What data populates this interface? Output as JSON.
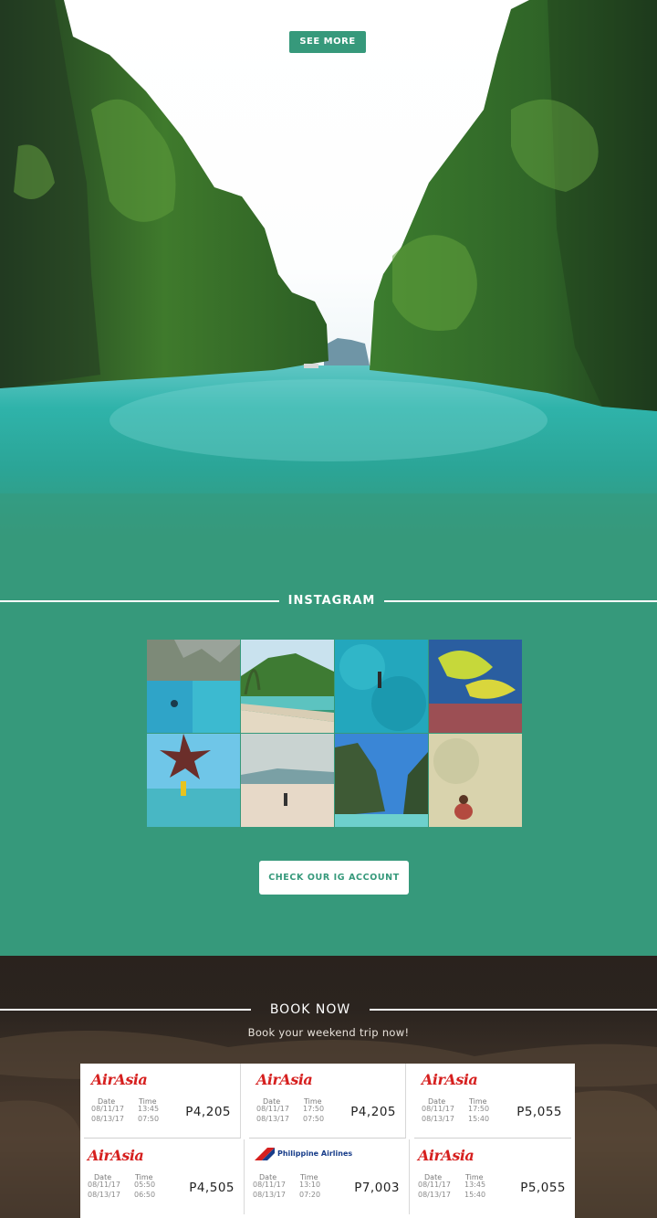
{
  "hero": {
    "see_more_label": "SEE MORE"
  },
  "instagram": {
    "title": "INSTAGRAM",
    "photos": [
      {
        "icon": "photo-cliffs-snorkel"
      },
      {
        "icon": "photo-beach-palms"
      },
      {
        "icon": "photo-swimmer-lagoon"
      },
      {
        "icon": "photo-fish-coral"
      },
      {
        "icon": "photo-starfish"
      },
      {
        "icon": "photo-sandbar"
      },
      {
        "icon": "photo-lagoon-cliffs"
      },
      {
        "icon": "photo-woman-shallows"
      }
    ],
    "button_label": "CHECK OUR IG ACCOUNT"
  },
  "book": {
    "title": "BOOK NOW",
    "subtitle": "Book your weekend trip now!",
    "date_label": "Date",
    "time_label": "Time",
    "flights": [
      {
        "airline": "AirAsia",
        "dates": [
          "08/11/17",
          "08/13/17"
        ],
        "times": [
          "13:45",
          "07:50"
        ],
        "price": "P4,205"
      },
      {
        "airline": "AirAsia",
        "dates": [
          "08/11/17",
          "08/13/17"
        ],
        "times": [
          "17:50",
          "07:50"
        ],
        "price": "P4,205"
      },
      {
        "airline": "AirAsia",
        "dates": [
          "08/11/17",
          "08/13/17"
        ],
        "times": [
          "17:50",
          "15:40"
        ],
        "price": "P5,055"
      },
      {
        "airline": "AirAsia",
        "dates": [
          "08/11/17",
          "08/13/17"
        ],
        "times": [
          "05:50",
          "06:50"
        ],
        "price": "P4,505"
      },
      {
        "airline": "Philippine Airlines",
        "dates": [
          "08/11/17",
          "08/13/17"
        ],
        "times": [
          "13:10",
          "07:20"
        ],
        "price": "P7,003"
      },
      {
        "airline": "AirAsia",
        "dates": [
          "08/11/17",
          "08/13/17"
        ],
        "times": [
          "13:45",
          "15:40"
        ],
        "price": "P5,055"
      }
    ]
  },
  "colors": {
    "accent": "#36997b",
    "airasia_red": "#d6201f",
    "pal_blue": "#183d8a"
  }
}
